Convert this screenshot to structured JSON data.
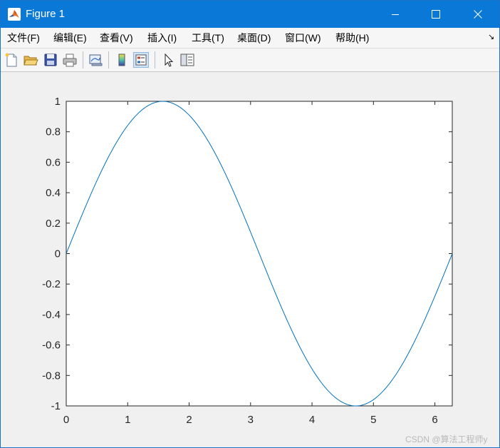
{
  "window": {
    "title": "Figure 1",
    "title_bar_color": "#0a78d7"
  },
  "title_bar_icons": [
    "matlab-logo-icon",
    "minimize-icon",
    "maximize-icon",
    "close-icon"
  ],
  "menu": {
    "items": [
      {
        "label": "文件(F)"
      },
      {
        "label": "编辑(E)"
      },
      {
        "label": "查看(V)"
      },
      {
        "label": "插入(I)"
      },
      {
        "label": "工具(T)"
      },
      {
        "label": "桌面(D)"
      },
      {
        "label": "窗口(W)"
      },
      {
        "label": "帮助(H)"
      }
    ],
    "dock_arrow": "↘"
  },
  "toolbar": {
    "buttons": [
      {
        "icon": "new-figure-icon"
      },
      {
        "icon": "open-file-icon"
      },
      {
        "icon": "save-icon"
      },
      {
        "icon": "print-icon"
      },
      {
        "icon": "link-plot-icon"
      },
      {
        "icon": "colorbar-icon"
      },
      {
        "icon": "legend-icon",
        "pressed": true
      },
      {
        "icon": "pointer-icon"
      },
      {
        "icon": "property-inspector-icon"
      }
    ]
  },
  "chart_data": {
    "type": "line",
    "title": "",
    "xlabel": "",
    "ylabel": "",
    "function": "sin(x)",
    "xlim": [
      0,
      6.283
    ],
    "ylim": [
      -1,
      1
    ],
    "xticks": [
      "0",
      "1",
      "2",
      "3",
      "4",
      "5",
      "6"
    ],
    "yticks": [
      "1",
      "0.8",
      "0.6",
      "0.4",
      "0.2",
      "0",
      "-0.2",
      "-0.4",
      "-0.6",
      "-0.8",
      "-1"
    ],
    "grid": false,
    "series": [
      {
        "color": "#0072bd",
        "x": [
          0,
          0.314,
          0.628,
          0.942,
          1.257,
          1.571,
          1.885,
          2.199,
          2.513,
          2.827,
          3.142,
          3.456,
          3.77,
          4.084,
          4.398,
          4.712,
          5.027,
          5.341,
          5.655,
          5.969,
          6.283
        ],
        "y": [
          0,
          0.309,
          0.588,
          0.809,
          0.951,
          1.0,
          0.951,
          0.809,
          0.588,
          0.309,
          0,
          -0.309,
          -0.588,
          -0.809,
          -0.951,
          -1.0,
          -0.951,
          -0.809,
          -0.588,
          -0.309,
          0
        ]
      }
    ]
  },
  "watermark": "CSDN @算法工程师y"
}
